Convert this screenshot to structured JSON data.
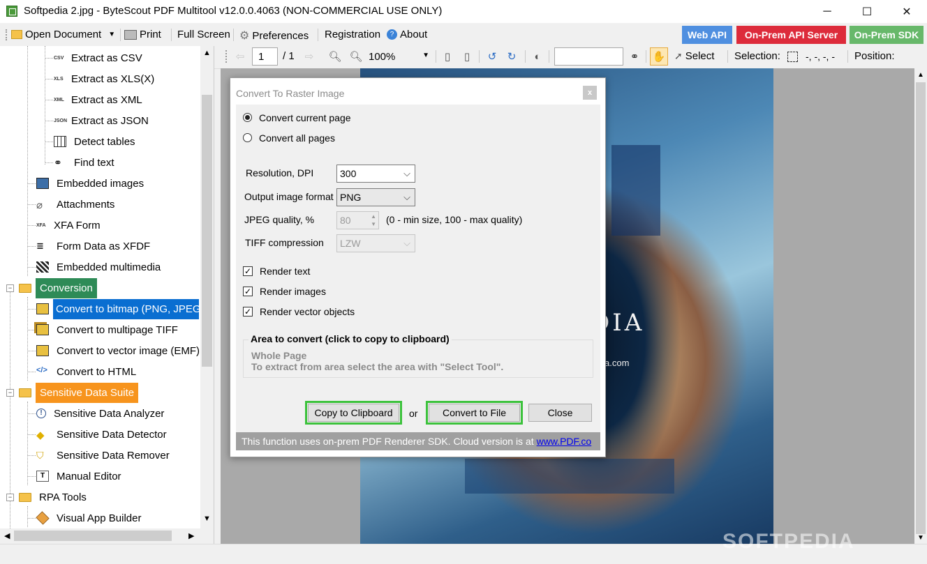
{
  "window": {
    "title": "Softpedia 2.jpg - ByteScout PDF Multitool v12.0.0.4063 (NON-COMMERCIAL USE ONLY)",
    "minimize": "─",
    "maximize": "☐",
    "close": "✕"
  },
  "menu": {
    "open_document": "Open Document",
    "print": "Print",
    "full_screen": "Full Screen",
    "preferences": "Preferences",
    "registration": "Registration",
    "about": "About",
    "web_api": "Web API",
    "on_prem_api": "On-Prem API Server",
    "on_prem_sdk": "On-Prem SDK",
    "colors": {
      "web_api": "#4f8fe0",
      "on_prem_api": "#dd2b3b",
      "on_prem_sdk": "#67b86a"
    }
  },
  "tree": {
    "items": [
      {
        "label": "Extract as CSV",
        "ext": "CSV"
      },
      {
        "label": "Extract as XLS(X)",
        "ext": "XLS"
      },
      {
        "label": "Extract as XML",
        "ext": "XML"
      },
      {
        "label": "Extract as JSON",
        "ext": "JSON"
      },
      {
        "label": "Detect tables"
      },
      {
        "label": "Find text"
      },
      {
        "label": "Embedded images"
      },
      {
        "label": "Attachments"
      },
      {
        "label": "XFA Form",
        "ext": "XFA"
      },
      {
        "label": "Form Data as XFDF"
      },
      {
        "label": "Embedded multimedia"
      },
      {
        "label": "Conversion"
      },
      {
        "label": "Convert to bitmap (PNG, JPEG, ..."
      },
      {
        "label": "Convert to multipage TIFF"
      },
      {
        "label": "Convert to vector image (EMF)"
      },
      {
        "label": "Convert to HTML"
      },
      {
        "label": "Sensitive Data Suite"
      },
      {
        "label": "Sensitive Data Analyzer"
      },
      {
        "label": "Sensitive Data Detector"
      },
      {
        "label": "Sensitive Data Remover"
      },
      {
        "label": "Manual Editor"
      },
      {
        "label": "RPA Tools"
      },
      {
        "label": "Visual App Builder"
      }
    ],
    "colors": {
      "conversion_bg": "#2e8b57",
      "sensitive_bg": "#f7941d",
      "selected_bg": "#0a6ed1"
    }
  },
  "viewer": {
    "page": "1",
    "page_total": "/ 1",
    "zoom": "100%",
    "search_value": "",
    "select_label": "Select",
    "selection_label": "Selection:",
    "selection_value": "-, -, -, -",
    "position_label": "Position:",
    "watermark": "SOFTPEDIA"
  },
  "dialog": {
    "title": "Convert To Raster Image",
    "close_label": "x",
    "convert_current": "Convert current page",
    "convert_all": "Convert all pages",
    "resolution_label": "Resolution, DPI",
    "resolution_value": "300",
    "format_label": "Output image format",
    "format_value": "PNG",
    "jpeg_label": "JPEG quality, %",
    "jpeg_value": "80",
    "jpeg_hint": "(0 - min size, 100 - max quality)",
    "tiff_label": "TIFF compression",
    "tiff_value": "LZW",
    "render_text": "Render text",
    "render_images": "Render images",
    "render_vector": "Render vector objects",
    "area_title": "Area to convert (click to copy to clipboard)",
    "area_line1": "Whole Page",
    "area_line2": "To extract from area select the area with \"Select Tool\".",
    "copy_btn": "Copy to Clipboard",
    "or_label": "or",
    "convert_btn": "Convert to File",
    "close_btn": "Close",
    "footer_text": "This function uses on-prem PDF Renderer SDK. Cloud version is at",
    "footer_link": "www.PDF.co"
  }
}
